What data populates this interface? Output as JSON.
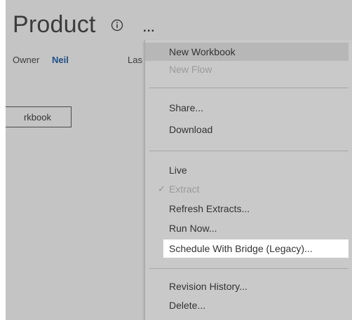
{
  "header": {
    "title": "Product",
    "info_icon": "info-circle-icon",
    "more_label": "..."
  },
  "meta": {
    "owner_label": "Owner",
    "owner_name": "Neil",
    "last_label": "Las"
  },
  "workbook_button": {
    "label": "rkbook"
  },
  "menu": {
    "items": {
      "new_workbook": "New Workbook",
      "new_flow": "New Flow",
      "share": "Share...",
      "download": "Download",
      "live": "Live",
      "extract": "Extract",
      "refresh_extracts": "Refresh Extracts...",
      "run_now": "Run Now...",
      "schedule_bridge": "Schedule With Bridge (Legacy)...",
      "revision_history": "Revision History...",
      "delete": "Delete..."
    },
    "check_glyph": "✓"
  },
  "colors": {
    "page_bg": "#c4c4c4",
    "menu_bg": "#c9c9c9",
    "hover_bg": "#b7b7b7",
    "highlight_bg": "#ffffff",
    "owner_link": "#1f4d86",
    "disabled_text": "#9b9b9b"
  }
}
